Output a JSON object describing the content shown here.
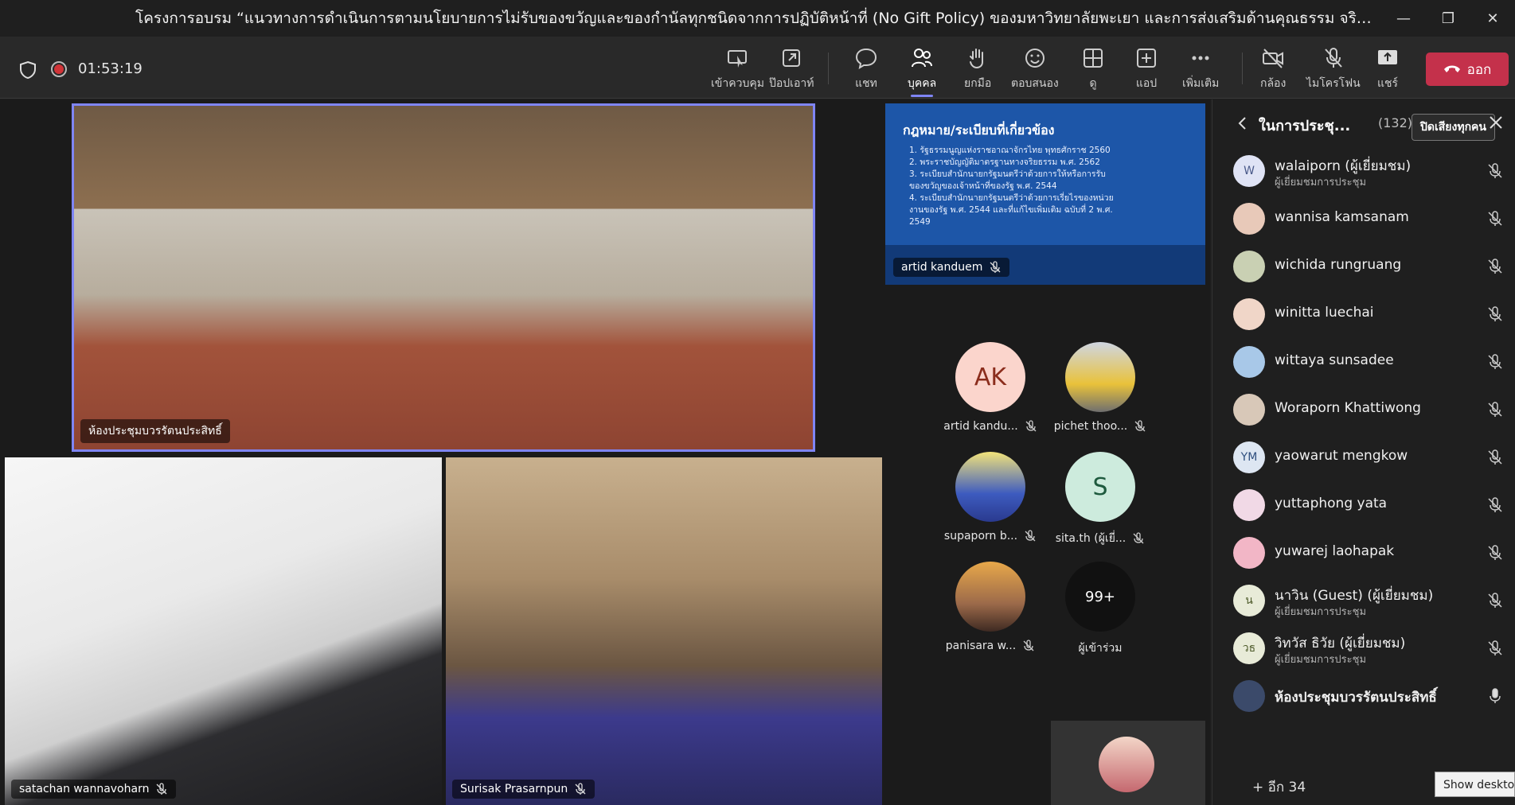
{
  "window": {
    "title": "โครงการอบรม “แนวทางการดำเนินการตามนโยบายการไม่รับของขวัญและของกำนัลทุกชนิดจากการปฏิบัติหน้าที่ (No Gift Policy) ของมหาวิทยาลัยพะเยา และการส่งเสริมด้านคุณธรรม จริยธรรม ของบุคลากรมหาวิทยาลัยพ...",
    "minimize": "—",
    "maximize": "❐",
    "close": "✕"
  },
  "toolbar": {
    "timer": "01:53:19",
    "buttons": [
      {
        "label": "เข้าควบคุม",
        "icon": "take-control-icon"
      },
      {
        "label": "ป๊อปเอาท์",
        "icon": "pop-out-icon"
      },
      {
        "label": "แชท",
        "icon": "chat-icon"
      },
      {
        "label": "บุคคล",
        "icon": "people-icon"
      },
      {
        "label": "ยกมือ",
        "icon": "raise-hand-icon"
      },
      {
        "label": "ตอบสนอง",
        "icon": "react-icon"
      },
      {
        "label": "ดู",
        "icon": "view-icon"
      },
      {
        "label": "แอป",
        "icon": "apps-icon"
      },
      {
        "label": "เพิ่มเติม",
        "icon": "more-icon"
      },
      {
        "label": "กล้อง",
        "icon": "camera-off-icon"
      },
      {
        "label": "ไมโครโฟน",
        "icon": "mic-off-icon"
      },
      {
        "label": "แชร์",
        "icon": "share-icon"
      }
    ],
    "leave_label": "ออก",
    "accent": "#7f85f5",
    "leave_color": "#c4314b"
  },
  "stage": {
    "main_tile_label": "ห้องประชุมบวรรัตนประสิทธิ์",
    "bottom_left_label": "satachan wannavoharn",
    "bottom_middle_label": "Surisak Prasarnpun",
    "slide": {
      "title": "กฎหมาย/ระเบียบที่เกี่ยวข้อง",
      "items": [
        "1. รัฐธรรมนูญแห่งราชอาณาจักรไทย พุทธศักราช 2560",
        "2. พระราชบัญญัติมาตรฐานทางจริยธรรม พ.ศ. 2562",
        "3. ระเบียบสำนักนายกรัฐมนตรีว่าด้วยการให้หรือการรับของขวัญของเจ้าหน้าที่ของรัฐ พ.ศ. 2544",
        "4. ระเบียบสำนักนายกรัฐมนตรีว่าด้วยการเรี่ยไรของหน่วยงานของรัฐ พ.ศ. 2544 และที่แก้ไขเพิ่มเติม ฉบับที่ 2 พ.ศ. 2549"
      ],
      "presenter_label": "artid kanduem"
    },
    "gallery": [
      {
        "name": "artid kandu...",
        "initials": "AK"
      },
      {
        "name": "pichet thoo...",
        "initials": ""
      },
      {
        "name": "supaporn b...",
        "initials": ""
      },
      {
        "name": "sita.th (ผู้เยี่...",
        "initials": "S"
      },
      {
        "name": "panisara w...",
        "initials": ""
      },
      {
        "name": "ผู้เข้าร่วม",
        "initials": "99+"
      }
    ]
  },
  "panel": {
    "title": "ในการประชุ...",
    "count": "(132)",
    "mute_all": "ปิดเสียงทุกคน",
    "participants": [
      {
        "name": "walaiporn (ผู้เยี่ยมชม)",
        "sub": "ผู้เยี่ยมชมการประชุม",
        "initials": "W"
      },
      {
        "name": "wannisa kamsanam",
        "sub": "",
        "initials": ""
      },
      {
        "name": "wichida rungruang",
        "sub": "",
        "initials": ""
      },
      {
        "name": "winitta luechai",
        "sub": "",
        "initials": ""
      },
      {
        "name": "wittaya sunsadee",
        "sub": "",
        "initials": ""
      },
      {
        "name": "Woraporn Khattiwong",
        "sub": "",
        "initials": ""
      },
      {
        "name": "yaowarut mengkow",
        "sub": "",
        "initials": "YM"
      },
      {
        "name": "yuttaphong yata",
        "sub": "",
        "initials": ""
      },
      {
        "name": "yuwarej laohapak",
        "sub": "",
        "initials": ""
      },
      {
        "name": "นาวิน (Guest) (ผู้เยี่ยมชม)",
        "sub": "ผู้เยี่ยมชมการประชุม",
        "initials": "น"
      },
      {
        "name": "วิทวัส ธิวัย (ผู้เยี่ยมชม)",
        "sub": "ผู้เยี่ยมชมการประชุม",
        "initials": "วธ"
      },
      {
        "name": "ห้องประชุมบวรรัตนประสิทธิ์",
        "sub": "",
        "initials": ""
      }
    ],
    "more": "+ อีก 34"
  },
  "tooltip": "Show desktop"
}
